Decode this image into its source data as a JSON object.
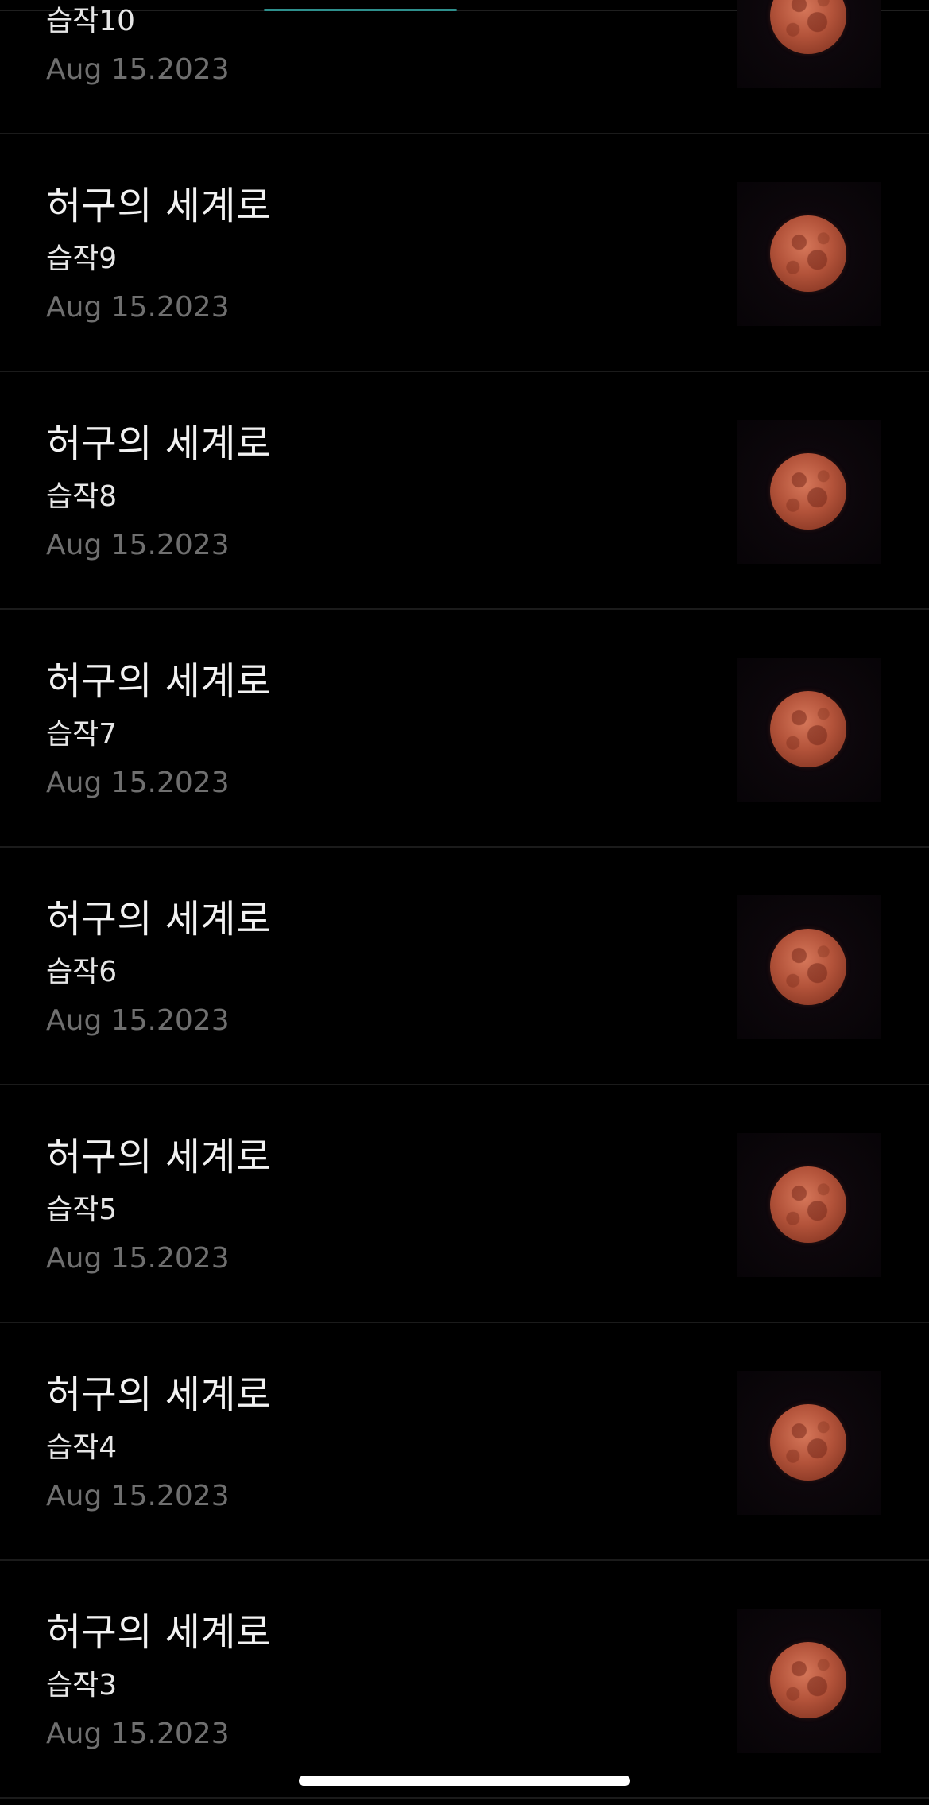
{
  "items": [
    {
      "title": "",
      "subtitle": "습작10",
      "date": "Aug 15.2023",
      "thumbnail": "blood-moon-image"
    },
    {
      "title": "허구의 세계로",
      "subtitle": "습작9",
      "date": "Aug 15.2023",
      "thumbnail": "blood-moon-image"
    },
    {
      "title": "허구의 세계로",
      "subtitle": "습작8",
      "date": "Aug 15.2023",
      "thumbnail": "blood-moon-image"
    },
    {
      "title": "허구의 세계로",
      "subtitle": "습작7",
      "date": "Aug 15.2023",
      "thumbnail": "blood-moon-image"
    },
    {
      "title": "허구의 세계로",
      "subtitle": "습작6",
      "date": "Aug 15.2023",
      "thumbnail": "blood-moon-image"
    },
    {
      "title": "허구의 세계로",
      "subtitle": "습작5",
      "date": "Aug 15.2023",
      "thumbnail": "blood-moon-image"
    },
    {
      "title": "허구의 세계로",
      "subtitle": "습작4",
      "date": "Aug 15.2023",
      "thumbnail": "blood-moon-image"
    },
    {
      "title": "허구의 세계로",
      "subtitle": "습작3",
      "date": "Aug 15.2023",
      "thumbnail": "blood-moon-image"
    }
  ],
  "colors": {
    "background": "#000000",
    "tab_indicator": "#2e8f8c",
    "title": "#f2f2f2",
    "subtitle": "#e6e6e6",
    "date": "#6f6f6f",
    "divider": "#1b1b1b"
  }
}
